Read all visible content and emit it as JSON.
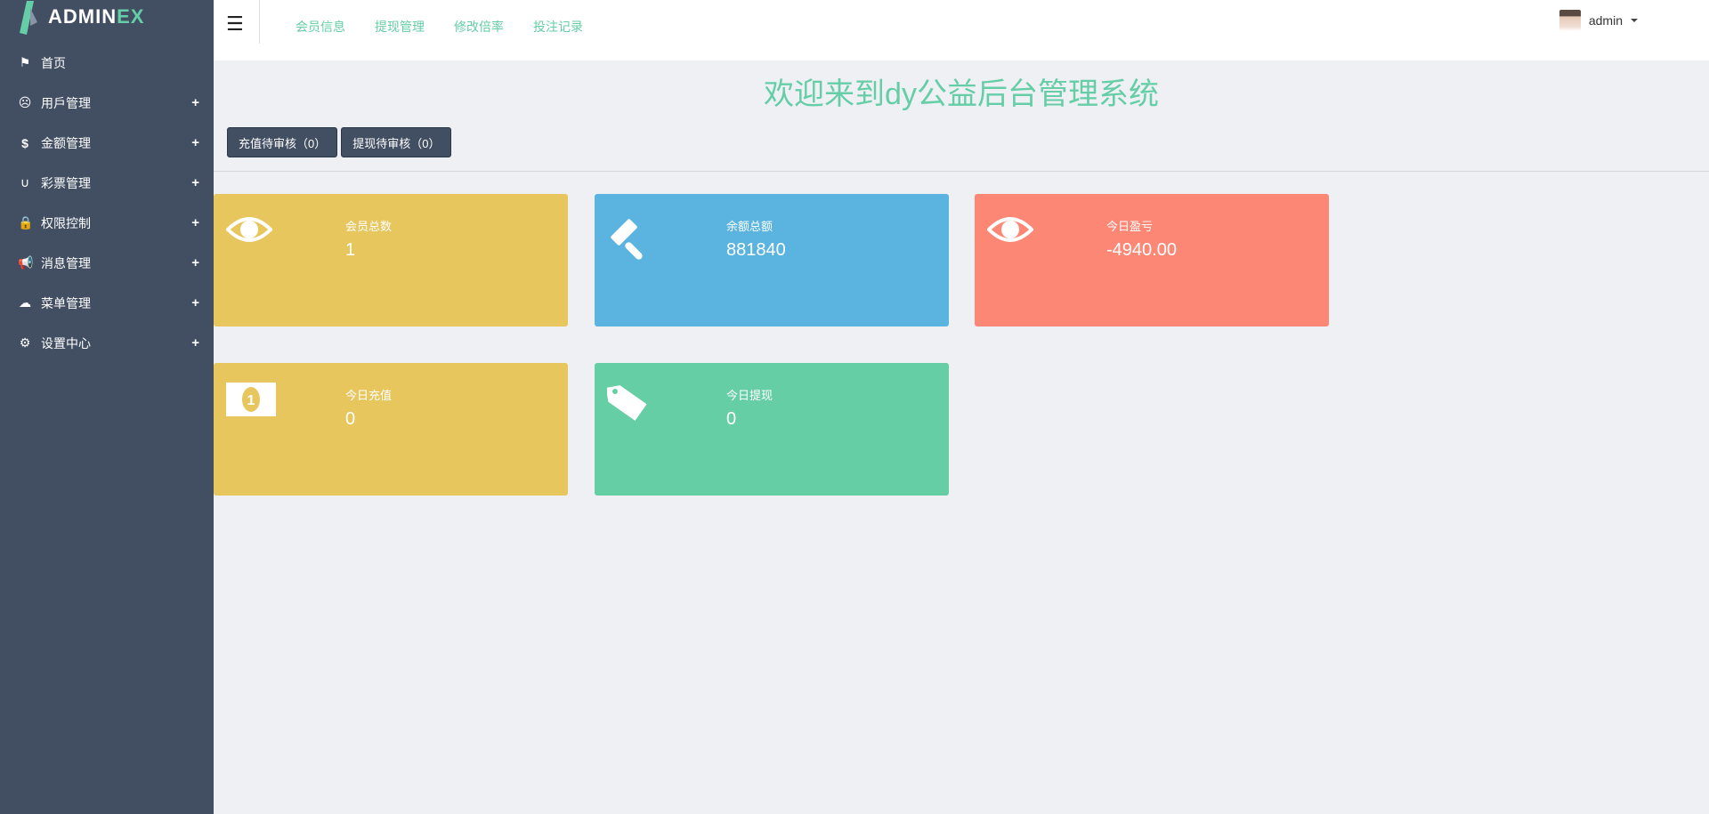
{
  "brand": {
    "prefix": "ADMIN",
    "suffix": "EX"
  },
  "sidebar": {
    "items": [
      {
        "label": "首页",
        "icon": "flag-icon",
        "expandable": false
      },
      {
        "label": "用戶管理",
        "icon": "frown-icon",
        "expandable": true
      },
      {
        "label": "金额管理",
        "icon": "dollar-icon",
        "expandable": true
      },
      {
        "label": "彩票管理",
        "icon": "magnet-icon",
        "expandable": true
      },
      {
        "label": "权限控制",
        "icon": "lock-icon",
        "expandable": true
      },
      {
        "label": "消息管理",
        "icon": "bullhorn-icon",
        "expandable": true
      },
      {
        "label": "菜单管理",
        "icon": "cloud-icon",
        "expandable": true
      },
      {
        "label": "设置中心",
        "icon": "gear-icon",
        "expandable": true
      }
    ],
    "plus": "+"
  },
  "header": {
    "nav": [
      "会员信息",
      "提现管理",
      "修改倍率",
      "投注记录"
    ],
    "user": "admin"
  },
  "main": {
    "title": "欢迎来到dy公益后台管理系统",
    "buttons": [
      "充值待审核（0）",
      "提现待审核（0）"
    ],
    "cards": [
      {
        "label": "会员总数",
        "value": "1",
        "icon": "eye-icon",
        "color": "#e8c65e"
      },
      {
        "label": "余额总额",
        "value": "881840",
        "icon": "gavel-icon",
        "color": "#5ab4df"
      },
      {
        "label": "今日盈亏",
        "value": "-4940.00",
        "icon": "eye-icon",
        "color": "#fc8775"
      },
      {
        "label": "今日充值",
        "value": "0",
        "icon": "money-icon",
        "color": "#e8c65e"
      },
      {
        "label": "今日提现",
        "value": "0",
        "icon": "tag-icon",
        "color": "#66cea5"
      }
    ]
  }
}
